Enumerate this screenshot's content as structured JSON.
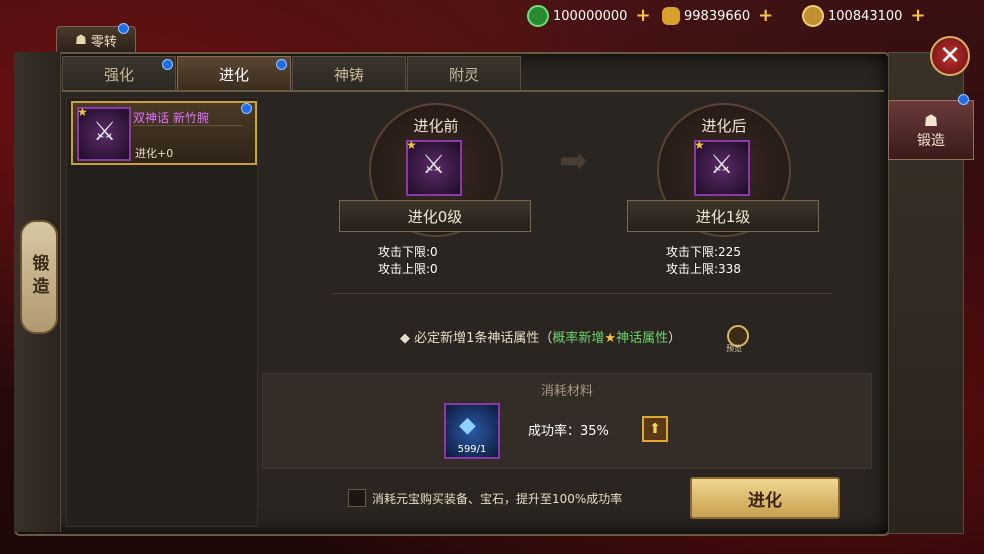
{
  "currency": [
    {
      "icon": "jade-coin-icon",
      "value": "100000000",
      "color": "#3bc24a"
    },
    {
      "icon": "gold-ingot-icon",
      "value": "99839660",
      "color": "#f2c34a"
    },
    {
      "icon": "copper-coin-icon",
      "value": "100843100",
      "color": "#e0b040"
    }
  ],
  "top_tab": {
    "label": "零转"
  },
  "tabs": [
    "强化",
    "进化",
    "神铸",
    "附灵"
  ],
  "active_tab": 1,
  "left_pillar": {
    "label": "锻造"
  },
  "side_tab": {
    "label": "锻造"
  },
  "equipment": {
    "name": "双神话 新竹腕",
    "level": "进化+0",
    "star_color": "#f5c542",
    "name_color": "#e070ff"
  },
  "before": {
    "title": "进化前",
    "level": "进化0级",
    "stats": [
      "攻击下限:0",
      "攻击上限:0"
    ]
  },
  "after": {
    "title": "进化后",
    "level": "进化1级",
    "stats": [
      "攻击下限:225",
      "攻击上限:338"
    ]
  },
  "info": {
    "prefix": "◆ 必定新增1条神话属性（",
    "green": "概率新增",
    "star": "★",
    "green2": "神话属性",
    "suffix": "）",
    "preview": "预览"
  },
  "materials": {
    "title": "消耗材料",
    "count": "599/1",
    "rate": "成功率：35%"
  },
  "checkbox_label": "消耗元宝购买装备、宝石，提升至100%成功率",
  "evolve_button": "进化"
}
